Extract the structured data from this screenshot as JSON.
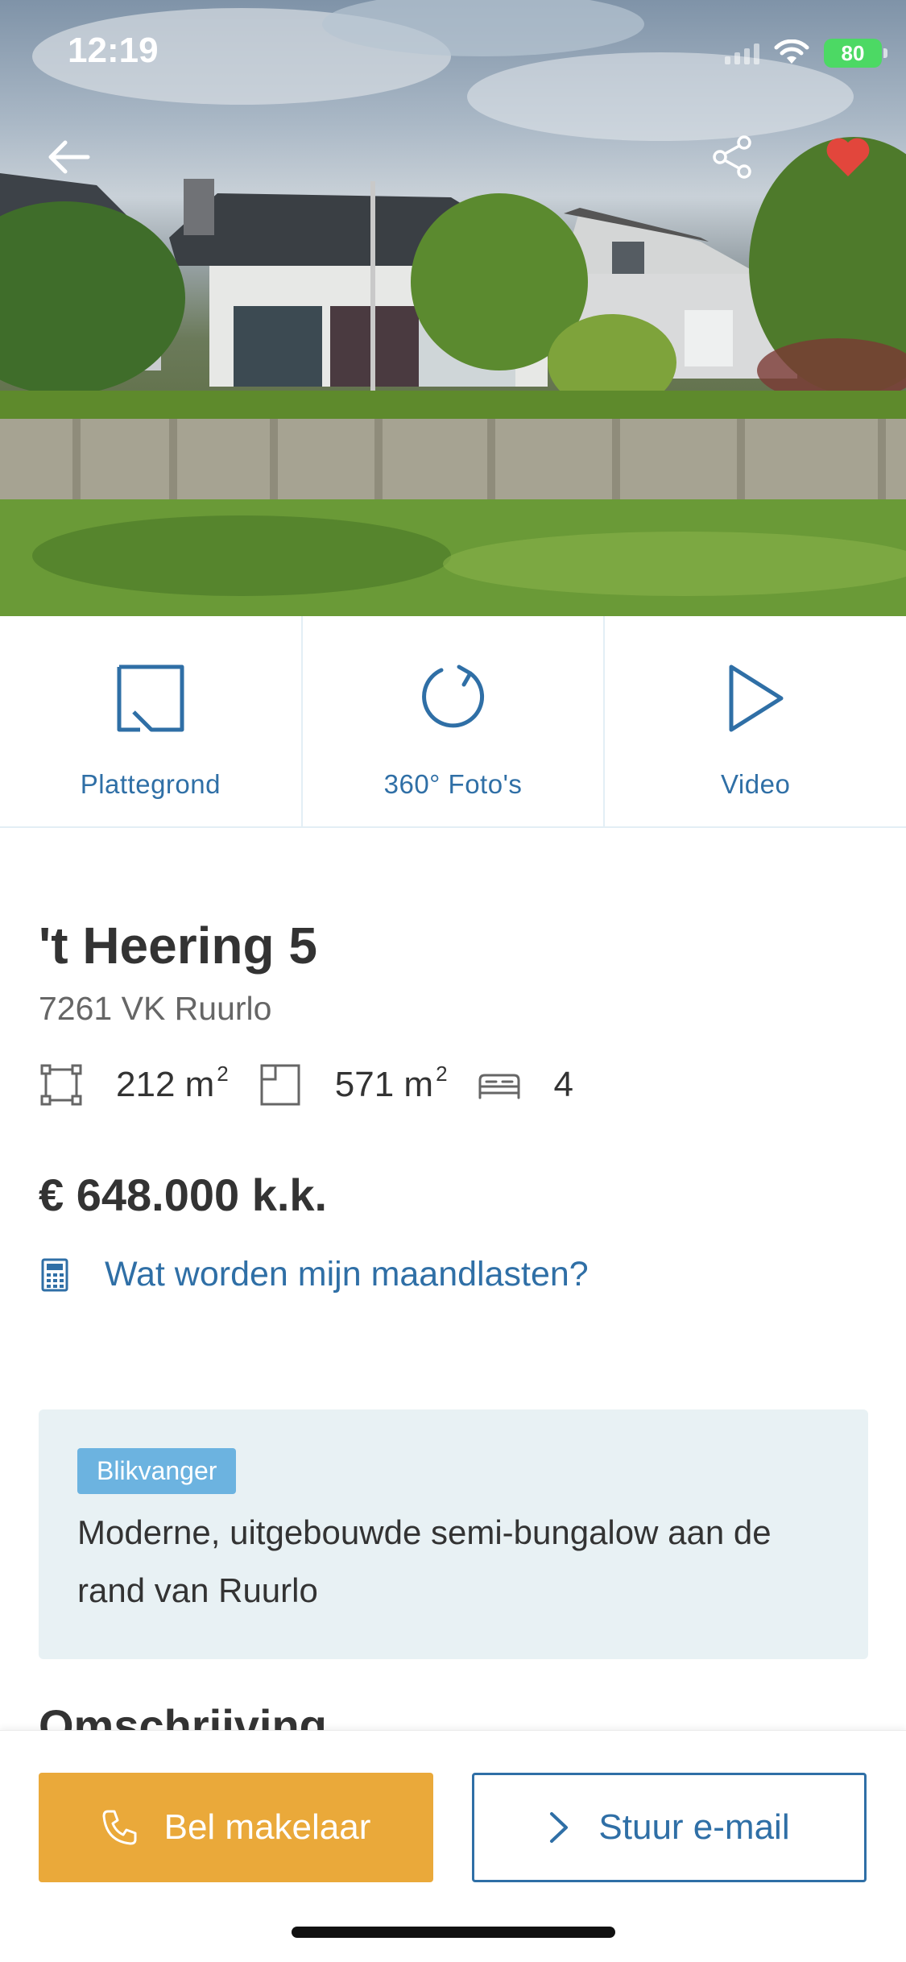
{
  "status_bar": {
    "time": "12:19",
    "battery": "80"
  },
  "hero": {
    "icons": {
      "back": "arrow-left-icon",
      "share": "share-icon",
      "favorite": "heart-icon"
    },
    "favorite_color": "#e2463c"
  },
  "media_tabs": [
    {
      "label": "Plattegrond",
      "icon": "floorplan-icon"
    },
    {
      "label": "360° Foto's",
      "icon": "rotate-360-icon"
    },
    {
      "label": "Video",
      "icon": "play-icon"
    }
  ],
  "listing": {
    "title": "'t Heering 5",
    "subtitle": "7261 VK Ruurlo",
    "features": {
      "living_area": "212 m",
      "plot_area": "571 m",
      "area_unit_sup": "2",
      "bedrooms": "4"
    },
    "price": "€ 648.000 k.k.",
    "mortgage_link": "Wat worden mijn maandlasten?"
  },
  "eye_catcher": {
    "badge": "Blikvanger",
    "text": "Moderne, uitgebouwde semi-bungalow aan de rand van Ruurlo"
  },
  "description_heading": "Omschrijving",
  "actions": {
    "call": "Bel makelaar",
    "email": "Stuur e-mail"
  },
  "colors": {
    "accent_blue": "#2f6fa6",
    "call_orange": "#eaa93a",
    "badge_blue": "#6cb3e0",
    "panel_bg": "#e8f1f4"
  }
}
